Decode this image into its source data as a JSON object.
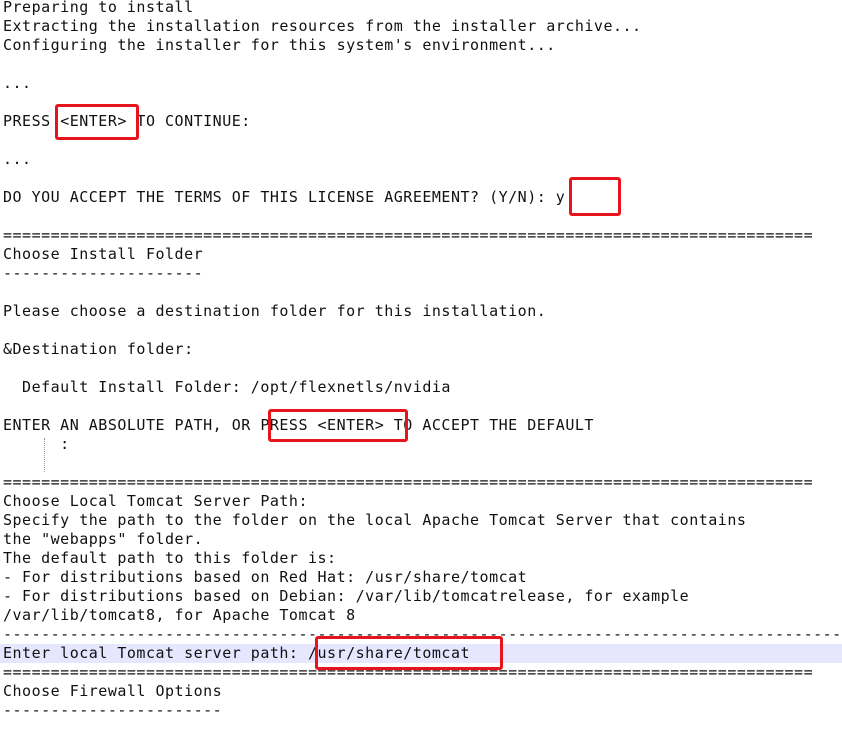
{
  "lines": {
    "l01": "Preparing to install",
    "l02": "Extracting the installation resources from the installer archive...",
    "l03": "Configuring the installer for this system's environment...",
    "l04": "...",
    "l05a": "PRESS ",
    "l05b": "<ENTER>",
    "l05c": " TO CONTINUE:",
    "l06": "...",
    "l07a": "DO YOU ACCEPT THE TERMS OF THIS LICENSE AGREEMENT? (Y/N): ",
    "l07b": "y",
    "sep1": "=====================================================================================",
    "l08": "Choose Install Folder",
    "l09": "---------------------",
    "l10": "Please choose a destination folder for this installation.",
    "l11": "&Destination folder:",
    "l12": "  Default Install Folder: /opt/flexnetls/nvidia",
    "l13a": "ENTER AN ABSOLUTE PATH, OR ",
    "l13b": "PRESS <ENTER>",
    "l13c": " TO ACCEPT THE DEFAULT",
    "l14": "      :",
    "sep2": "=====================================================================================",
    "l15": "Choose Local Tomcat Server Path:",
    "l16": "Specify the path to the folder on the local Apache Tomcat Server that contains",
    "l17": "the \"webapps\" folder.",
    "l18": "The default path to this folder is:",
    "l19": "- For distributions based on Red Hat: /usr/share/tomcat",
    "l20": "- For distributions based on Debian: /var/lib/tomcatrelease, for example",
    "l21": "/var/lib/tomcat8, for Apache Tomcat 8",
    "sep3": "-------------------------------------------------------------------------------------------",
    "l22a": "Enter local Tomcat server path: ",
    "l22b": "/usr/share/tomcat",
    "sep4": "=====================================================================================",
    "l23": "Choose Firewall Options",
    "l24": "-----------------------"
  },
  "colors": {
    "highlight_box": "#e8141b",
    "current_line": "#e6e6ff"
  }
}
